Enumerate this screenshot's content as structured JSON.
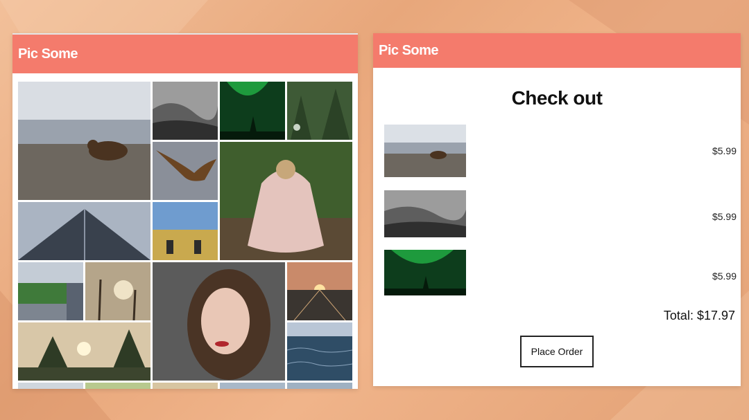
{
  "left_window": {
    "brand": "Pic Some",
    "photos": [
      {
        "icon": "bear-photo-icon"
      },
      {
        "icon": "foggy-forest-photo-icon"
      },
      {
        "icon": "aurora-photo-icon"
      },
      {
        "icon": "green-forest-photo-icon"
      },
      {
        "icon": "eagle-photo-icon"
      },
      {
        "icon": "pug-blanket-photo-icon"
      },
      {
        "icon": "skyscraper-photo-icon"
      },
      {
        "icon": "feet-field-photo-icon"
      },
      {
        "icon": "city-park-photo-icon"
      },
      {
        "icon": "dead-trees-photo-icon"
      },
      {
        "icon": "woman-portrait-photo-icon"
      },
      {
        "icon": "sunset-rails-photo-icon"
      },
      {
        "icon": "mountain-sunset-photo-icon"
      },
      {
        "icon": "ocean-photo-icon"
      }
    ]
  },
  "right_window": {
    "brand": "Pic Some",
    "title": "Check out",
    "items": [
      {
        "icon": "bear-photo-icon",
        "price": "$5.99"
      },
      {
        "icon": "foggy-forest-photo-icon",
        "price": "$5.99"
      },
      {
        "icon": "aurora-photo-icon",
        "price": "$5.99"
      }
    ],
    "total": "Total: $17.97",
    "order_button": "Place Order"
  },
  "colors": {
    "header": "#f47b6c",
    "background": "#e8a77b"
  }
}
